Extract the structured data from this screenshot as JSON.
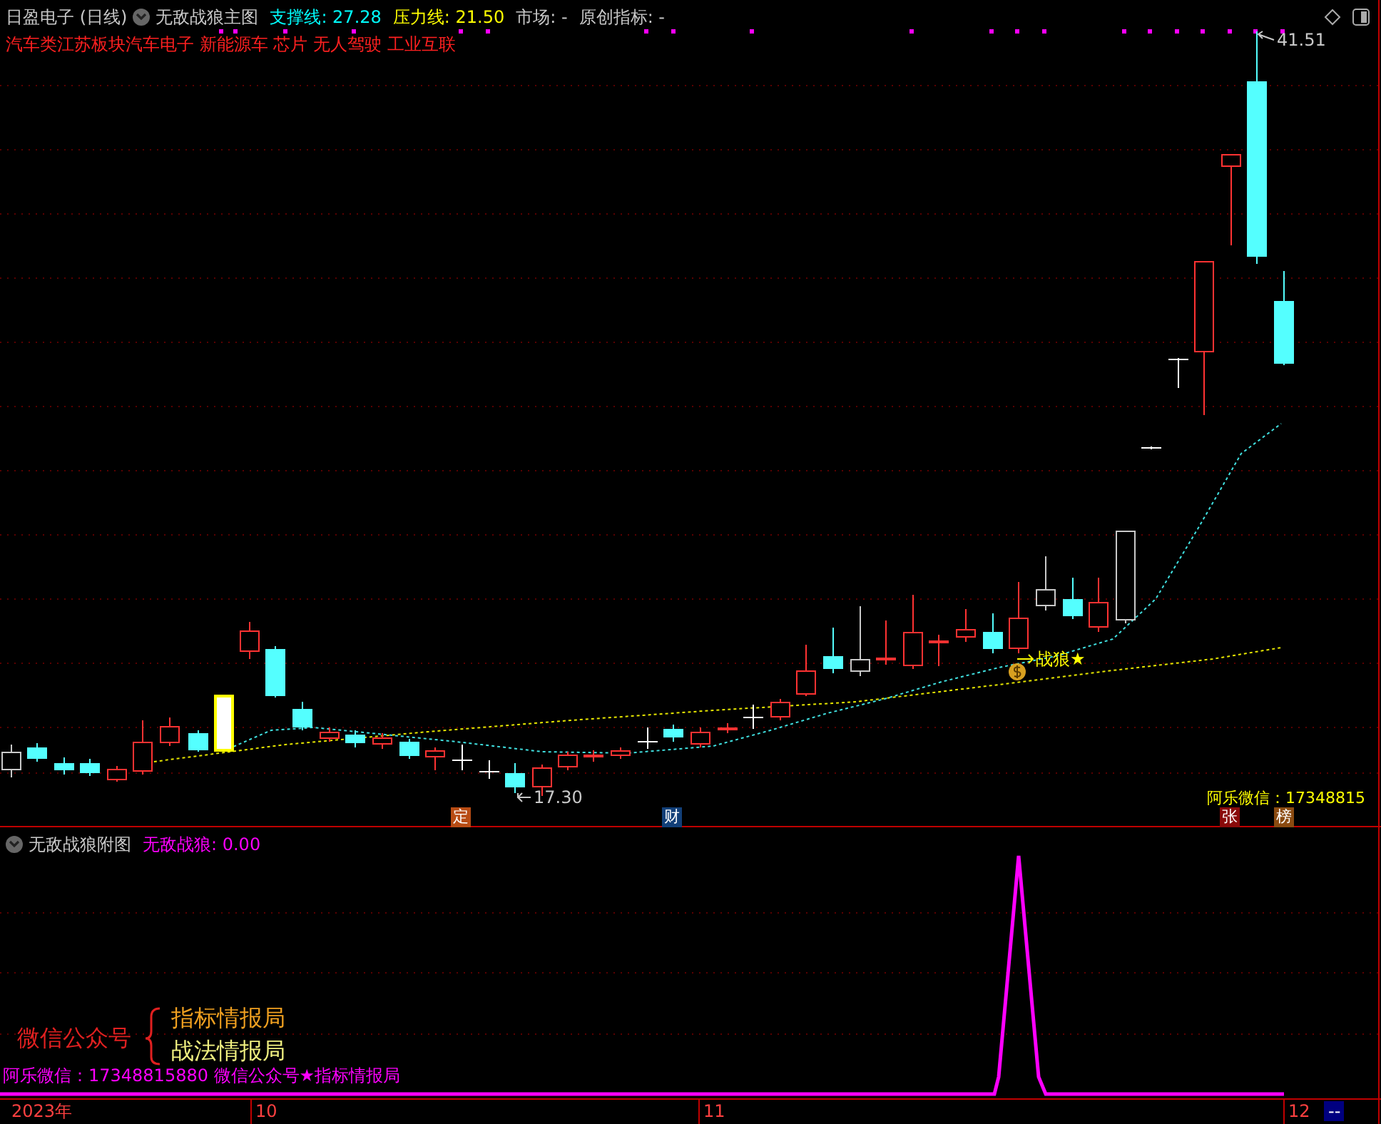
{
  "header": {
    "stock": "日盈电子 (日线)",
    "indicator": "无敌战狼主图",
    "readings": [
      {
        "text": "支撑线: 27.28",
        "color": "#00ffff"
      },
      {
        "text": "压力线: 21.50",
        "color": "#ffff00"
      },
      {
        "text": "市场: -",
        "color": "#c8c8c8"
      },
      {
        "text": "原创指标: -",
        "color": "#c8c8c8"
      }
    ],
    "sectors": "汽车类江苏板块汽车电子 新能源车 芯片 无人驾驶 工业互联"
  },
  "main_chart": {
    "price_labels": [
      "41.51",
      "17.30"
    ],
    "signal_label": "战狼★",
    "contact": "阿乐微信：17348815",
    "event_badges": [
      {
        "text": "定",
        "color": "#b84c14"
      },
      {
        "text": "财",
        "color": "#123f78"
      },
      {
        "text": "张",
        "color": "#8a0a0a"
      },
      {
        "text": "榜",
        "color": "#8a4a10"
      }
    ]
  },
  "sub_chart": {
    "title": "无敌战狼附图",
    "reading": "无敌战狼: 0.00",
    "promo_label": "微信公众号",
    "promo_lines": [
      "指标情报局",
      "战法情报局"
    ],
    "contact": "阿乐微信：17348815880 微信公众号★指标情报局"
  },
  "time_axis": {
    "labels": [
      "2023年",
      "10",
      "11",
      "12"
    ],
    "end_box": "--"
  }
}
